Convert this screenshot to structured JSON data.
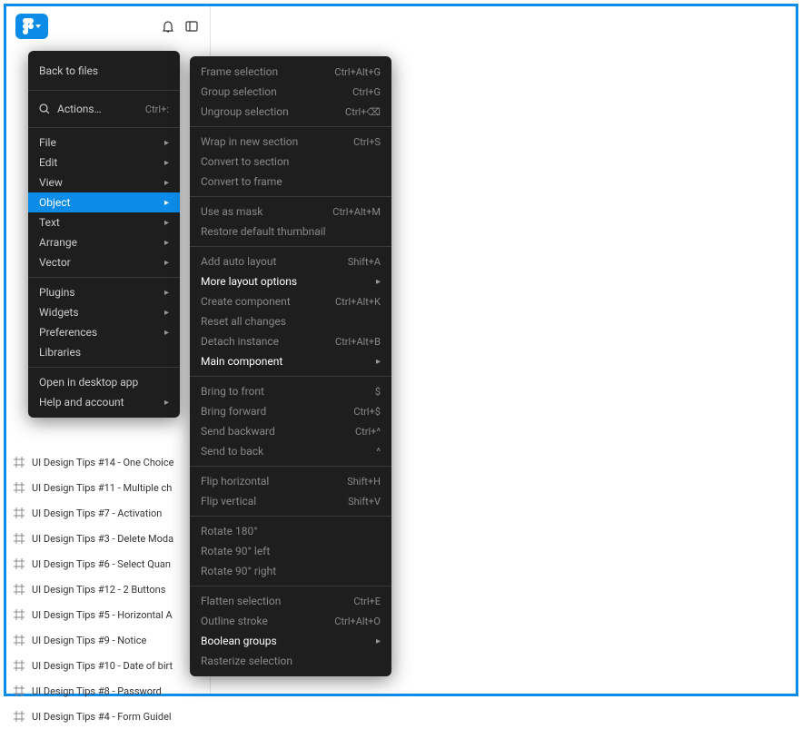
{
  "toolbar": {
    "notifications_icon": "notifications",
    "sidebar_icon": "panel"
  },
  "mainMenu": {
    "back": "Back to files",
    "actions": "Actions…",
    "actions_shortcut": "Ctrl+:",
    "items": [
      {
        "label": "File",
        "sub": true
      },
      {
        "label": "Edit",
        "sub": true
      },
      {
        "label": "View",
        "sub": true
      },
      {
        "label": "Object",
        "sub": true,
        "selected": true
      },
      {
        "label": "Text",
        "sub": true
      },
      {
        "label": "Arrange",
        "sub": true
      },
      {
        "label": "Vector",
        "sub": true
      }
    ],
    "items2": [
      {
        "label": "Plugins",
        "sub": true
      },
      {
        "label": "Widgets",
        "sub": true
      },
      {
        "label": "Preferences",
        "sub": true
      },
      {
        "label": "Libraries",
        "sub": false
      }
    ],
    "items3": [
      {
        "label": "Open in desktop app",
        "sub": false
      },
      {
        "label": "Help and account",
        "sub": true
      }
    ]
  },
  "subMenu": {
    "groups": [
      [
        {
          "label": "Frame selection",
          "shortcut": "Ctrl+Alt+G",
          "dim": true
        },
        {
          "label": "Group selection",
          "shortcut": "Ctrl+G",
          "dim": true
        },
        {
          "label": "Ungroup selection",
          "shortcut": "Ctrl+⌫",
          "dim": true
        }
      ],
      [
        {
          "label": "Wrap in new section",
          "shortcut": "Ctrl+S",
          "dim": true
        },
        {
          "label": "Convert to section",
          "dim": true
        },
        {
          "label": "Convert to frame",
          "dim": true
        }
      ],
      [
        {
          "label": "Use as mask",
          "shortcut": "Ctrl+Alt+M",
          "dim": true
        },
        {
          "label": "Restore default thumbnail",
          "dim": true
        }
      ],
      [
        {
          "label": "Add auto layout",
          "shortcut": "Shift+A",
          "dim": true
        },
        {
          "label": "More layout options",
          "sub": true,
          "bold": true
        },
        {
          "label": "Create component",
          "shortcut": "Ctrl+Alt+K",
          "dim": true
        },
        {
          "label": "Reset all changes",
          "dim": true
        },
        {
          "label": "Detach instance",
          "shortcut": "Ctrl+Alt+B",
          "dim": true
        },
        {
          "label": "Main component",
          "sub": true,
          "bold": true
        }
      ],
      [
        {
          "label": "Bring to front",
          "shortcut": "$",
          "dim": true
        },
        {
          "label": "Bring forward",
          "shortcut": "Ctrl+$",
          "dim": true
        },
        {
          "label": "Send backward",
          "shortcut": "Ctrl+^",
          "dim": true
        },
        {
          "label": "Send to back",
          "shortcut": "^",
          "dim": true
        }
      ],
      [
        {
          "label": "Flip horizontal",
          "shortcut": "Shift+H",
          "dim": true
        },
        {
          "label": "Flip vertical",
          "shortcut": "Shift+V",
          "dim": true
        }
      ],
      [
        {
          "label": "Rotate 180°",
          "dim": true
        },
        {
          "label": "Rotate 90° left",
          "dim": true
        },
        {
          "label": "Rotate 90° right",
          "dim": true
        }
      ],
      [
        {
          "label": "Flatten selection",
          "shortcut": "Ctrl+E",
          "dim": true
        },
        {
          "label": "Outline stroke",
          "shortcut": "Ctrl+Alt+O",
          "dim": true
        },
        {
          "label": "Boolean groups",
          "sub": true,
          "bold": true
        },
        {
          "label": "Rasterize selection",
          "dim": true
        }
      ]
    ]
  },
  "layers": [
    "UI Design Tips #14 - One Choice",
    "UI Design Tips #11 - Multiple ch",
    "UI Design Tips #7 - Activation",
    "UI Design Tips #3 - Delete Moda",
    "UI Design Tips #6 - Select Quan",
    "UI Design Tips #12 - 2 Buttons",
    "UI Design Tips #5 - Horizontal A",
    "UI Design Tips #9 - Notice",
    "UI Design Tips #10 - Date of birt",
    "UI Design Tips #8 - Password",
    "UI Design Tips #4 - Form Guidel"
  ]
}
